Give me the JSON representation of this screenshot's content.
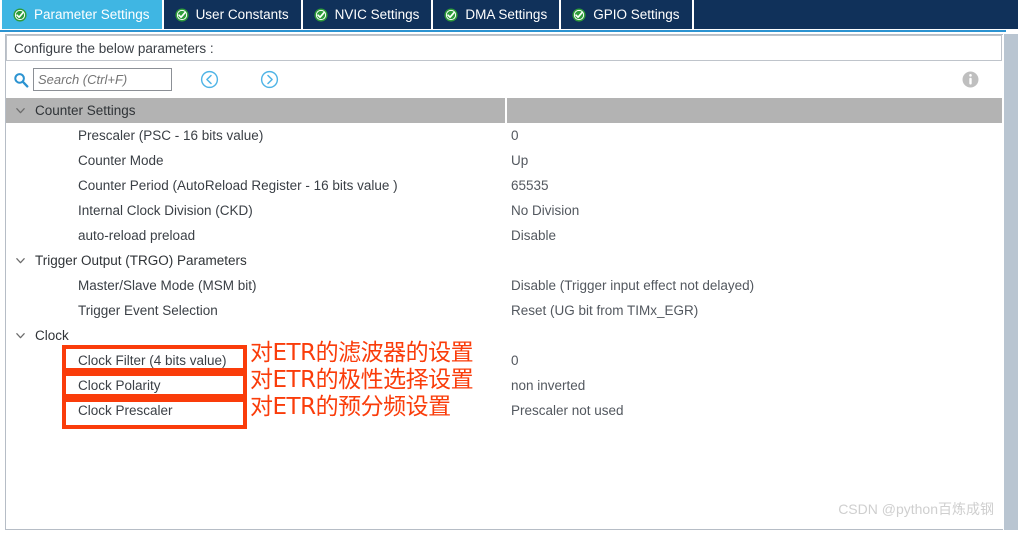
{
  "window": {
    "tabs": [
      {
        "label": "Parameter Settings",
        "icon": "check-circle-icon",
        "active": true
      },
      {
        "label": "User Constants",
        "icon": "check-circle-icon",
        "active": false
      },
      {
        "label": "NVIC Settings",
        "icon": "check-circle-icon",
        "active": false
      },
      {
        "label": "DMA Settings",
        "icon": "check-circle-icon",
        "active": false
      },
      {
        "label": "GPIO Settings",
        "icon": "check-circle-icon",
        "active": false
      }
    ],
    "instruction": "Configure the below parameters :"
  },
  "toolbar": {
    "search_icon": "search-icon",
    "search_value": "",
    "search_placeholder": "Search (Ctrl+F)",
    "prev_icon": "chevron-left-circle-icon",
    "next_icon": "chevron-right-circle-icon",
    "info_icon": "info-circle-icon"
  },
  "tree": {
    "groups": [
      {
        "title": "Counter Settings",
        "shaded": true,
        "rows": [
          {
            "label": "Prescaler (PSC - 16 bits value)",
            "value": "0"
          },
          {
            "label": "Counter Mode",
            "value": "Up"
          },
          {
            "label": "Counter Period (AutoReload Register - 16 bits value )",
            "value": "65535"
          },
          {
            "label": "Internal Clock Division (CKD)",
            "value": "No Division"
          },
          {
            "label": "auto-reload preload",
            "value": "Disable"
          }
        ]
      },
      {
        "title": "Trigger Output (TRGO) Parameters",
        "shaded": false,
        "rows": [
          {
            "label": "Master/Slave Mode (MSM bit)",
            "value": "Disable (Trigger input effect not delayed)"
          },
          {
            "label": "Trigger Event Selection",
            "value": "Reset (UG bit from TIMx_EGR)"
          }
        ]
      },
      {
        "title": "Clock",
        "shaded": false,
        "rows": [
          {
            "label": "Clock Filter (4 bits value)",
            "value": "0"
          },
          {
            "label": "Clock Polarity",
            "value": "non inverted"
          },
          {
            "label": "Clock Prescaler",
            "value": "Prescaler not used"
          }
        ]
      }
    ]
  },
  "annotations": {
    "color": "#fa3c0a",
    "notes": [
      {
        "text": "对ETR的滤波器的设置"
      },
      {
        "text": "对ETR的极性选择设置"
      },
      {
        "text": "对ETR的预分频设置"
      }
    ]
  },
  "watermark": "CSDN @python百炼成钢"
}
